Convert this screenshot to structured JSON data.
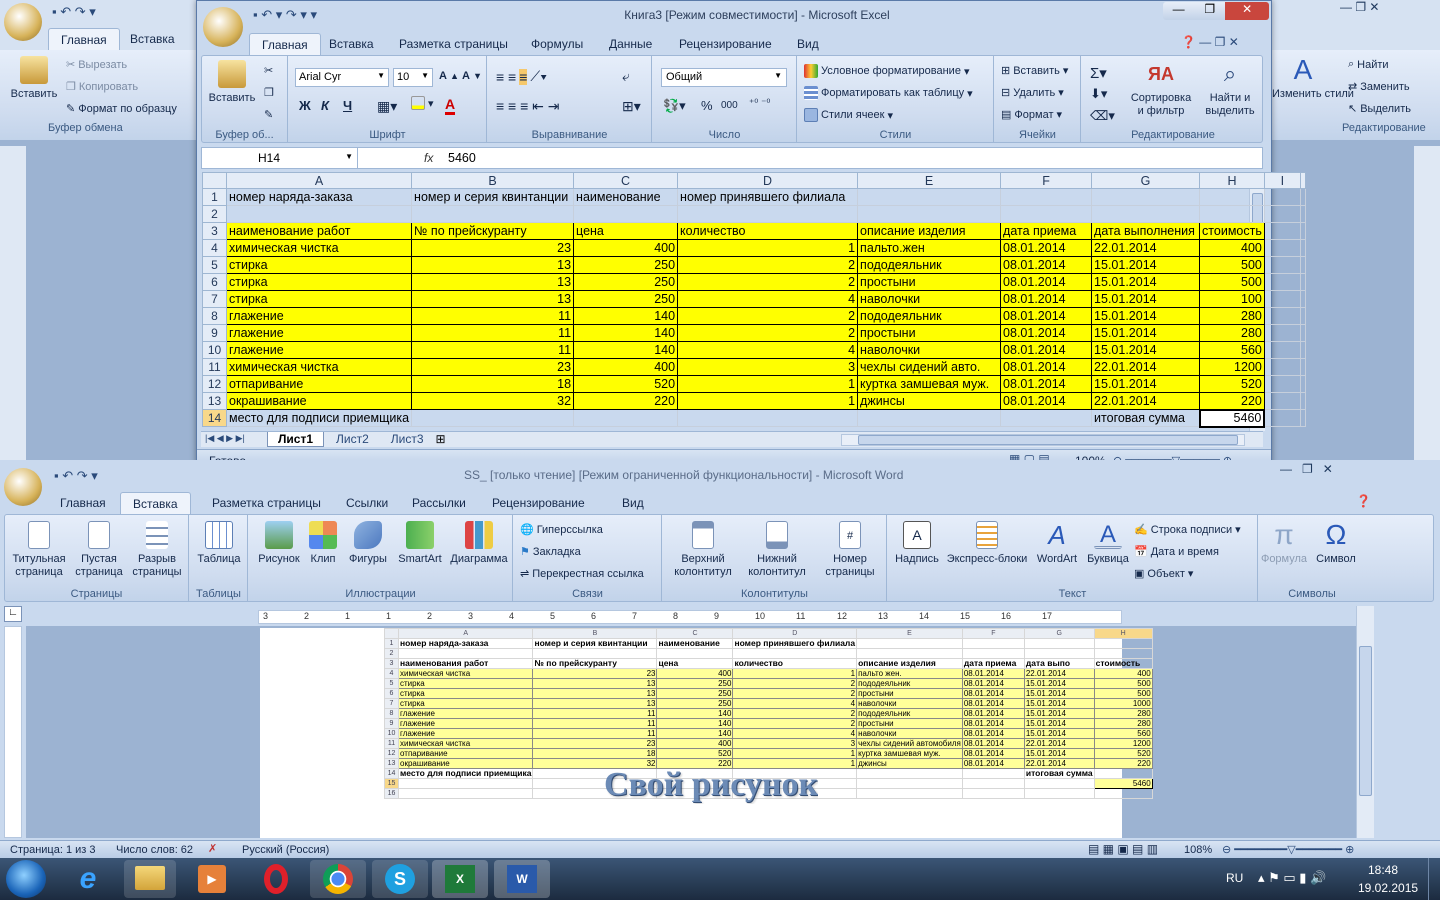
{
  "word_back": {
    "title": "",
    "tabs": [
      "Главная",
      "Вставка"
    ],
    "clipboard": {
      "paste": "Вставить",
      "cut": "Вырезать",
      "copy": "Копировать",
      "format": "Формат по образцу",
      "group": "Буфер обмена"
    },
    "editing": {
      "find": "Найти",
      "replace": "Заменить",
      "select": "Выделить",
      "styles": "Изменить стили",
      "group": "Редактирование"
    }
  },
  "excel": {
    "title": "Книга3  [Режим совместимости] - Microsoft Excel",
    "tabs": [
      "Главная",
      "Вставка",
      "Разметка страницы",
      "Формулы",
      "Данные",
      "Рецензирование",
      "Вид"
    ],
    "clipboard": {
      "paste": "Вставить",
      "group": "Буфер об..."
    },
    "font": {
      "name": "Arial Cyr",
      "size": "10",
      "bold": "Ж",
      "italic": "К",
      "underline": "Ч",
      "group": "Шрифт"
    },
    "align_group": "Выравнивание",
    "number": {
      "format": "Общий",
      "group": "Число",
      "pct": "%",
      "thousands": "000"
    },
    "styles": {
      "cond": "Условное форматирование",
      "table": "Форматировать как таблицу",
      "cell": "Стили ячеек",
      "group": "Стили"
    },
    "cells": {
      "insert": "Вставить",
      "delete": "Удалить",
      "format": "Формат",
      "group": "Ячейки"
    },
    "editing": {
      "sort": "Сортировка\nи фильтр",
      "find": "Найти и\nвыделить",
      "group": "Редактирование"
    },
    "namebox": "H14",
    "fx": "fx",
    "formula": "5460",
    "columns": [
      "A",
      "B",
      "C",
      "D",
      "E",
      "F",
      "G",
      "H",
      "I"
    ],
    "rows": [
      {
        "n": "1",
        "c": [
          "номер наряда-заказа",
          "номер и серия квинтанции",
          "наименование",
          "номер принявшего филиала",
          "",
          "",
          "",
          ""
        ]
      },
      {
        "n": "2",
        "c": [
          "",
          "",
          "",
          "",
          "",
          "",
          "",
          ""
        ]
      },
      {
        "n": "3",
        "c": [
          "наименование работ",
          "№ по прейскуранту",
          "цена",
          "количество",
          "описание изделия",
          "дата приема",
          "дата выполнения",
          "стоимость"
        ]
      },
      {
        "n": "4",
        "c": [
          "химическая чистка",
          "23",
          "400",
          "1",
          "пальто.жен",
          "08.01.2014",
          "22.01.2014",
          "400"
        ]
      },
      {
        "n": "5",
        "c": [
          "стирка",
          "13",
          "250",
          "2",
          "пододеяльник",
          "08.01.2014",
          "15.01.2014",
          "500"
        ]
      },
      {
        "n": "6",
        "c": [
          "стирка",
          "13",
          "250",
          "2",
          "простыни",
          "08.01.2014",
          "15.01.2014",
          "500"
        ]
      },
      {
        "n": "7",
        "c": [
          "стирка",
          "13",
          "250",
          "4",
          "наволочки",
          "08.01.2014",
          "15.01.2014",
          "100"
        ]
      },
      {
        "n": "8",
        "c": [
          "глажение",
          "11",
          "140",
          "2",
          "пододеяльник",
          "08.01.2014",
          "15.01.2014",
          "280"
        ]
      },
      {
        "n": "9",
        "c": [
          "глажение",
          "11",
          "140",
          "2",
          "простыни",
          "08.01.2014",
          "15.01.2014",
          "280"
        ]
      },
      {
        "n": "10",
        "c": [
          "глажение",
          "11",
          "140",
          "4",
          "наволочки",
          "08.01.2014",
          "15.01.2014",
          "560"
        ]
      },
      {
        "n": "11",
        "c": [
          "химическая чистка",
          "23",
          "400",
          "3",
          "чехлы сидений авто.",
          "08.01.2014",
          "22.01.2014",
          "1200"
        ]
      },
      {
        "n": "12",
        "c": [
          "отпаривание",
          "18",
          "520",
          "1",
          "куртка замшевая муж.",
          "08.01.2014",
          "15.01.2014",
          "520"
        ]
      },
      {
        "n": "13",
        "c": [
          "окрашивание",
          "32",
          "220",
          "1",
          "джинсы",
          "08.01.2014",
          "22.01.2014",
          "220"
        ]
      },
      {
        "n": "14",
        "c": [
          "место для подписи приемщика",
          "",
          "",
          "",
          "",
          "",
          "итоговая сумма",
          "5460"
        ]
      }
    ],
    "sheets": [
      "Лист1",
      "Лист2",
      "Лист3"
    ],
    "status": "Готово",
    "zoom": "100%"
  },
  "word": {
    "title": "SS_ [только чтение] [Режим ограниченной функциональности] - Microsoft Word",
    "tabs": [
      "Главная",
      "Вставка",
      "Разметка страницы",
      "Ссылки",
      "Рассылки",
      "Рецензирование",
      "Вид"
    ],
    "groups": {
      "pages": {
        "label": "Страницы",
        "title_page": "Титульная\nстраница",
        "blank": "Пустая\nстраница",
        "break": "Разрыв\nстраницы"
      },
      "tables": {
        "label": "Таблицы",
        "table": "Таблица"
      },
      "illustrations": {
        "label": "Иллюстрации",
        "picture": "Рисунок",
        "clip": "Клип",
        "shapes": "Фигуры",
        "smartart": "SmartArt",
        "chart": "Диаграмма"
      },
      "links": {
        "label": "Связи",
        "hyperlink": "Гиперссылка",
        "bookmark": "Закладка",
        "crossref": "Перекрестная ссылка"
      },
      "headers": {
        "label": "Колонтитулы",
        "header": "Верхний\nколонтитул",
        "footer": "Нижний\nколонтитул",
        "pagenum": "Номер\nстраницы"
      },
      "text": {
        "label": "Текст",
        "textbox": "Надпись",
        "quickparts": "Экспресс-блоки",
        "wordart": "WordArt",
        "dropcap": "Буквица",
        "sigline": "Строка подписи",
        "datetime": "Дата и время",
        "object": "Объект"
      },
      "symbols": {
        "label": "Символы",
        "formula": "Формула",
        "symbol": "Символ"
      }
    },
    "ruler": [
      "3",
      "2",
      "1",
      "1",
      "2",
      "3",
      "4",
      "5",
      "6",
      "7",
      "8",
      "9",
      "10",
      "11",
      "12",
      "13",
      "14",
      "15",
      "16",
      "17"
    ],
    "mini_rows": [
      {
        "n": "1",
        "c": [
          "номер наряда-заказа",
          "номер и серия квинтанции",
          "наименование",
          "номер принявшего филиала",
          "",
          "",
          "",
          ""
        ]
      },
      {
        "n": "2",
        "c": [
          "",
          "",
          "",
          "",
          "",
          "",
          "",
          ""
        ]
      },
      {
        "n": "3",
        "c": [
          "наименования работ",
          "№ по прейскуранту",
          "цена",
          "количество",
          "описание изделия",
          "дата приема",
          "дата выпо",
          "стоимость"
        ]
      },
      {
        "n": "4",
        "c": [
          "химическая чистка",
          "23",
          "400",
          "1",
          "пальто жен.",
          "08.01.2014",
          "22.01.2014",
          "400"
        ]
      },
      {
        "n": "5",
        "c": [
          "стирка",
          "13",
          "250",
          "2",
          "пододеяльник",
          "08.01.2014",
          "15.01.2014",
          "500"
        ]
      },
      {
        "n": "6",
        "c": [
          "стирка",
          "13",
          "250",
          "2",
          "простыни",
          "08.01.2014",
          "15.01.2014",
          "500"
        ]
      },
      {
        "n": "7",
        "c": [
          "стирка",
          "13",
          "250",
          "4",
          "наволочки",
          "08.01.2014",
          "15.01.2014",
          "1000"
        ]
      },
      {
        "n": "8",
        "c": [
          "глажение",
          "11",
          "140",
          "2",
          "пододеяльник",
          "08.01.2014",
          "15.01.2014",
          "280"
        ]
      },
      {
        "n": "9",
        "c": [
          "глажение",
          "11",
          "140",
          "2",
          "простыни",
          "08.01.2014",
          "15.01.2014",
          "280"
        ]
      },
      {
        "n": "10",
        "c": [
          "глажение",
          "11",
          "140",
          "4",
          "наволочки",
          "08.01.2014",
          "15.01.2014",
          "560"
        ]
      },
      {
        "n": "11",
        "c": [
          "химическая чистка",
          "23",
          "400",
          "3",
          "чехлы сидений автомобиля",
          "08.01.2014",
          "22.01.2014",
          "1200"
        ]
      },
      {
        "n": "12",
        "c": [
          "отпаривание",
          "18",
          "520",
          "1",
          "куртка замшевая муж.",
          "08.01.2014",
          "15.01.2014",
          "520"
        ]
      },
      {
        "n": "13",
        "c": [
          "окрашивание",
          "32",
          "220",
          "1",
          "джинсы",
          "08.01.2014",
          "22.01.2014",
          "220"
        ]
      },
      {
        "n": "14",
        "c": [
          "место для подписи приемщика",
          "",
          "",
          "",
          "",
          "",
          "итоговая сумма",
          ""
        ]
      },
      {
        "n": "15",
        "c": [
          "",
          "",
          "",
          "",
          "",
          "",
          "",
          "5460"
        ]
      },
      {
        "n": "16",
        "c": [
          "",
          "",
          "",
          "",
          "",
          "",
          "",
          ""
        ]
      }
    ],
    "wordart": "Свой рисунок",
    "status": {
      "page": "Страница: 1 из 3",
      "words": "Число слов: 62",
      "lang": "Русский (Россия)",
      "zoom": "108%"
    }
  },
  "taskbar": {
    "lang": "RU",
    "time": "18:48",
    "date": "19.02.2015"
  },
  "colors": {
    "yellow": "#ffff00",
    "ribbon": "#cfdcef",
    "taskbar": "#1c2b3f"
  }
}
